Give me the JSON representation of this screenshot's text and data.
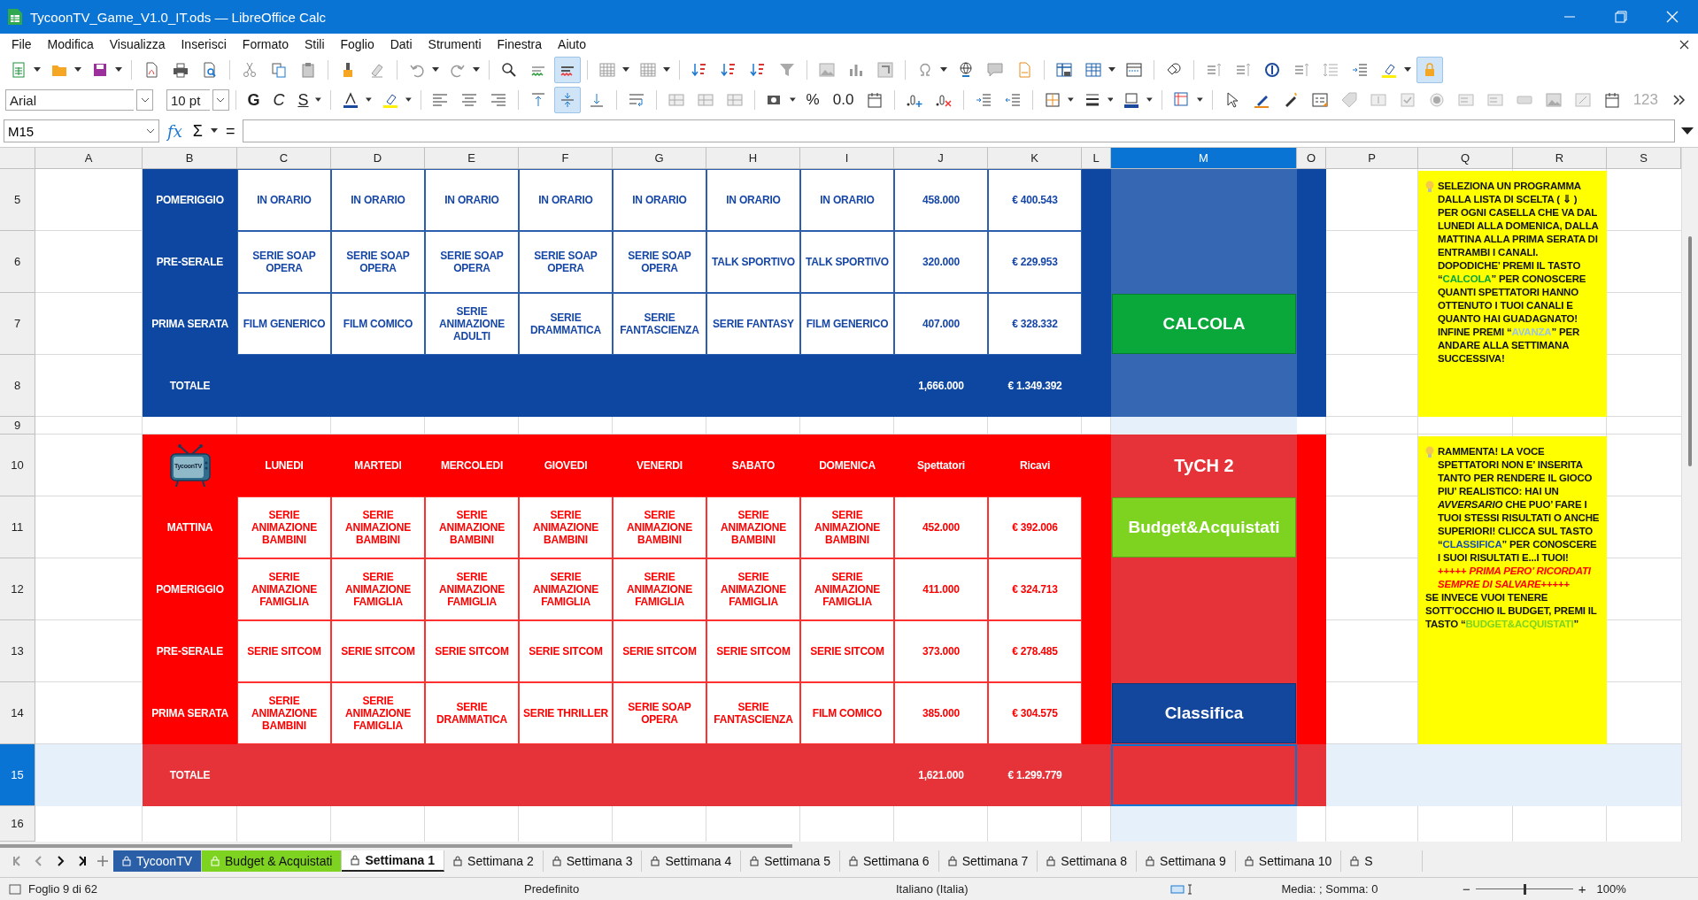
{
  "window": {
    "title": "TycoonTV_Game_V1.0_IT.ods — LibreOffice Calc"
  },
  "menu": [
    "File",
    "Modifica",
    "Visualizza",
    "Inserisci",
    "Formato",
    "Stili",
    "Foglio",
    "Dati",
    "Strumenti",
    "Finestra",
    "Aiuto"
  ],
  "standard_toolbar": {
    "auto_spellcheck": true,
    "protect": true
  },
  "format_toolbar": {
    "font_name": "Arial",
    "font_size": "10 pt",
    "style_buttons": [
      {
        "label": "G",
        "kind": "bold"
      },
      {
        "label": "C",
        "kind": "italic"
      },
      {
        "label": "S",
        "kind": "underline"
      }
    ],
    "align_middle": true,
    "number_buttons": [
      "%",
      "0.0"
    ],
    "number_format": {
      "label": "123",
      "disabled": true
    }
  },
  "formula_bar": {
    "cell": "M15",
    "symbols": [
      "fx",
      "Σ",
      "="
    ]
  },
  "columns": [
    {
      "label": "A",
      "selected": false
    },
    {
      "label": "B",
      "selected": false
    },
    {
      "label": "C",
      "selected": false
    },
    {
      "label": "D",
      "selected": false
    },
    {
      "label": "E",
      "selected": false
    },
    {
      "label": "F",
      "selected": false
    },
    {
      "label": "G",
      "selected": false
    },
    {
      "label": "H",
      "selected": false
    },
    {
      "label": "I",
      "selected": false
    },
    {
      "label": "J",
      "selected": false
    },
    {
      "label": "K",
      "selected": false
    },
    {
      "label": "L",
      "selected": false
    },
    {
      "label": "M",
      "selected": true
    },
    {
      "label": "O",
      "selected": false
    },
    {
      "label": "P",
      "selected": false
    },
    {
      "label": "Q",
      "selected": false
    },
    {
      "label": "R",
      "selected": false
    },
    {
      "label": "S",
      "selected": false
    }
  ],
  "rows": [
    {
      "label": "5",
      "selected": false
    },
    {
      "label": "6",
      "selected": false
    },
    {
      "label": "7",
      "selected": false
    },
    {
      "label": "8",
      "selected": false
    },
    {
      "label": "9",
      "selected": false
    },
    {
      "label": "10",
      "selected": false
    },
    {
      "label": "11",
      "selected": false
    },
    {
      "label": "12",
      "selected": false
    },
    {
      "label": "13",
      "selected": false
    },
    {
      "label": "14",
      "selected": false
    },
    {
      "label": "15",
      "selected": true
    },
    {
      "label": "16",
      "selected": false
    }
  ],
  "channel_1": {
    "rows": [
      {
        "slot": "POMERIGGIO",
        "programs": [
          "IN ORARIO",
          "IN ORARIO",
          "IN ORARIO",
          "IN ORARIO",
          "IN ORARIO",
          "IN ORARIO",
          "IN ORARIO"
        ],
        "viewers": "458.000",
        "revenue": "€ 400.543"
      },
      {
        "slot": "PRE-SERALE",
        "programs": [
          "SERIE SOAP OPERA",
          "SERIE SOAP OPERA",
          "SERIE SOAP OPERA",
          "SERIE SOAP OPERA",
          "SERIE SOAP OPERA",
          "TALK SPORTIVO",
          "TALK SPORTIVO"
        ],
        "viewers": "320.000",
        "revenue": "€ 229.953"
      },
      {
        "slot": "PRIMA SERATA",
        "programs": [
          "FILM GENERICO",
          "FILM COMICO",
          "SERIE ANIMAZIONE ADULTI",
          "SERIE DRAMMATICA",
          "SERIE FANTASCIENZA",
          "SERIE FANTASY",
          "FILM GENERICO"
        ],
        "viewers": "407.000",
        "revenue": "€ 328.332"
      }
    ],
    "total": {
      "label": "TOTALE",
      "viewers": "1,666.000",
      "revenue": "€ 1.349.392"
    }
  },
  "channel_2": {
    "logo": "TycoonTV",
    "days": [
      "LUNEDI",
      "MARTEDI",
      "MERCOLEDI",
      "GIOVEDI",
      "VENERDI",
      "SABATO",
      "DOMENICA"
    ],
    "viewers_header": "Spettatori",
    "revenue_header": "Ricavi",
    "rows": [
      {
        "slot": "MATTINA",
        "programs": [
          "SERIE ANIMAZIONE BAMBINI",
          "SERIE ANIMAZIONE BAMBINI",
          "SERIE ANIMAZIONE BAMBINI",
          "SERIE ANIMAZIONE BAMBINI",
          "SERIE ANIMAZIONE BAMBINI",
          "SERIE ANIMAZIONE BAMBINI",
          "SERIE ANIMAZIONE BAMBINI"
        ],
        "viewers": "452.000",
        "revenue": "€ 392.006"
      },
      {
        "slot": "POMERIGGIO",
        "programs": [
          "SERIE ANIMAZIONE FAMIGLIA",
          "SERIE ANIMAZIONE FAMIGLIA",
          "SERIE ANIMAZIONE FAMIGLIA",
          "SERIE ANIMAZIONE FAMIGLIA",
          "SERIE ANIMAZIONE FAMIGLIA",
          "SERIE ANIMAZIONE FAMIGLIA",
          "SERIE ANIMAZIONE FAMIGLIA"
        ],
        "viewers": "411.000",
        "revenue": "€ 324.713"
      },
      {
        "slot": "PRE-SERALE",
        "programs": [
          "SERIE SITCOM",
          "SERIE SITCOM",
          "SERIE SITCOM",
          "SERIE SITCOM",
          "SERIE SITCOM",
          "SERIE SITCOM",
          "SERIE SITCOM"
        ],
        "viewers": "373.000",
        "revenue": "€ 278.485"
      },
      {
        "slot": "PRIMA SERATA",
        "programs": [
          "SERIE ANIMAZIONE BAMBINI",
          "SERIE ANIMAZIONE FAMIGLIA",
          "SERIE DRAMMATICA",
          "SERIE THRILLER",
          "SERIE SOAP OPERA",
          "SERIE FANTASCIENZA",
          "FILM COMICO"
        ],
        "viewers": "385.000",
        "revenue": "€ 304.575"
      }
    ],
    "total": {
      "label": "TOTALE",
      "viewers": "1,621.000",
      "revenue": "€ 1.299.779"
    }
  },
  "controls": [
    {
      "kind": "button",
      "label": "CALCOLA",
      "color": "#0aa83a"
    },
    {
      "kind": "title",
      "label": "TyCH 2"
    },
    {
      "kind": "button",
      "label": "Budget&Acquistati",
      "color": "#7ed321"
    },
    {
      "kind": "button",
      "label": "Classifica",
      "color": "#12479d"
    }
  ],
  "notes": [
    {
      "paragraphs": [
        [
          {
            "kind": "plain",
            "text": "SELEZIONA UN PROGRAMMA DALLA LISTA DI SCELTA ( ⇓ ) PER OGNI CASELLA CHE VA DAL LUNEDI ALLA DOMENICA, DALLA MATTINA ALLA PRIMA SERATA DI ENTRAMBI I CANALI. DOPODICHE’ PREMI IL TASTO “"
          },
          {
            "kind": "calcola",
            "text": "CALCOLA"
          },
          {
            "kind": "plain",
            "text": "” PER CONOSCERE QUANTI SPETTATORI HANNO OTTENUTO I TUOI CANALI E QUANTO HAI GUADAGNATO! INFINE PREMI “"
          },
          {
            "kind": "avanza",
            "text": "AVANZA"
          },
          {
            "kind": "plain",
            "text": "” PER ANDARE ALLA SETTIMANA SUCCESSIVA!"
          }
        ]
      ]
    },
    {
      "paragraphs": [
        [
          {
            "kind": "plain",
            "text": "RAMMENTA! LA VOCE SPETTATORI NON E’ INSERITA TANTO PER RENDERE IL GIOCO PIU’ REALISTICO: HAI UN *AVVERSARIO*  CHE PUO’ FARE I TUOI STESSI RISULTATI O ANCHE SUPERIORI! CLICCA SUL TASTO “"
          },
          {
            "kind": "classifica",
            "text": "CLASSIFICA"
          },
          {
            "kind": "plain",
            "text": "” PER CONOSCERE I SUOI RISULTATI E...I TUOI! "
          },
          {
            "kind": "warning",
            "text": "+++++ "
          },
          {
            "kind": "warning_italic",
            "text": "PRIMA PERO’ RICORDATI SEMPRE DI SALVARE"
          },
          {
            "kind": "warning",
            "text": "+++++"
          }
        ],
        [
          {
            "kind": "plain",
            "text": "SE INVECE VUOI TENERE SOTT’OCCHIO IL BUDGET, PREMI IL TASTO “"
          },
          {
            "kind": "budget",
            "text": "BUDGET&ACQUISTATI"
          },
          {
            "kind": "plain",
            "text": "”"
          }
        ]
      ]
    }
  ],
  "sheet_tabs": [
    {
      "label": "TycoonTV",
      "selected": false,
      "color": "#2a5ea6"
    },
    {
      "label": "Budget & Acquistati",
      "selected": false,
      "color": "#7ed321"
    },
    {
      "label": "Settimana 1",
      "selected": true
    },
    {
      "label": "Settimana 2",
      "selected": false
    },
    {
      "label": "Settimana 3",
      "selected": false
    },
    {
      "label": "Settimana 4",
      "selected": false
    },
    {
      "label": "Settimana 5",
      "selected": false
    },
    {
      "label": "Settimana 6",
      "selected": false
    },
    {
      "label": "Settimana 7",
      "selected": false
    },
    {
      "label": "Settimana 8",
      "selected": false
    },
    {
      "label": "Settimana 9",
      "selected": false
    },
    {
      "label": "Settimana 10",
      "selected": false
    },
    {
      "label": "S",
      "selected": false
    }
  ],
  "status_bar": {
    "sheet": "Foglio 9 di 62",
    "page_style": "Predefinito",
    "language": "Italiano (Italia)",
    "summary": "Media: ; Somma: 0",
    "zoom_out": "−",
    "zoom_in": "+",
    "zoom": {
      "level": 0.5
    },
    "zoom_percent": "100%"
  }
}
